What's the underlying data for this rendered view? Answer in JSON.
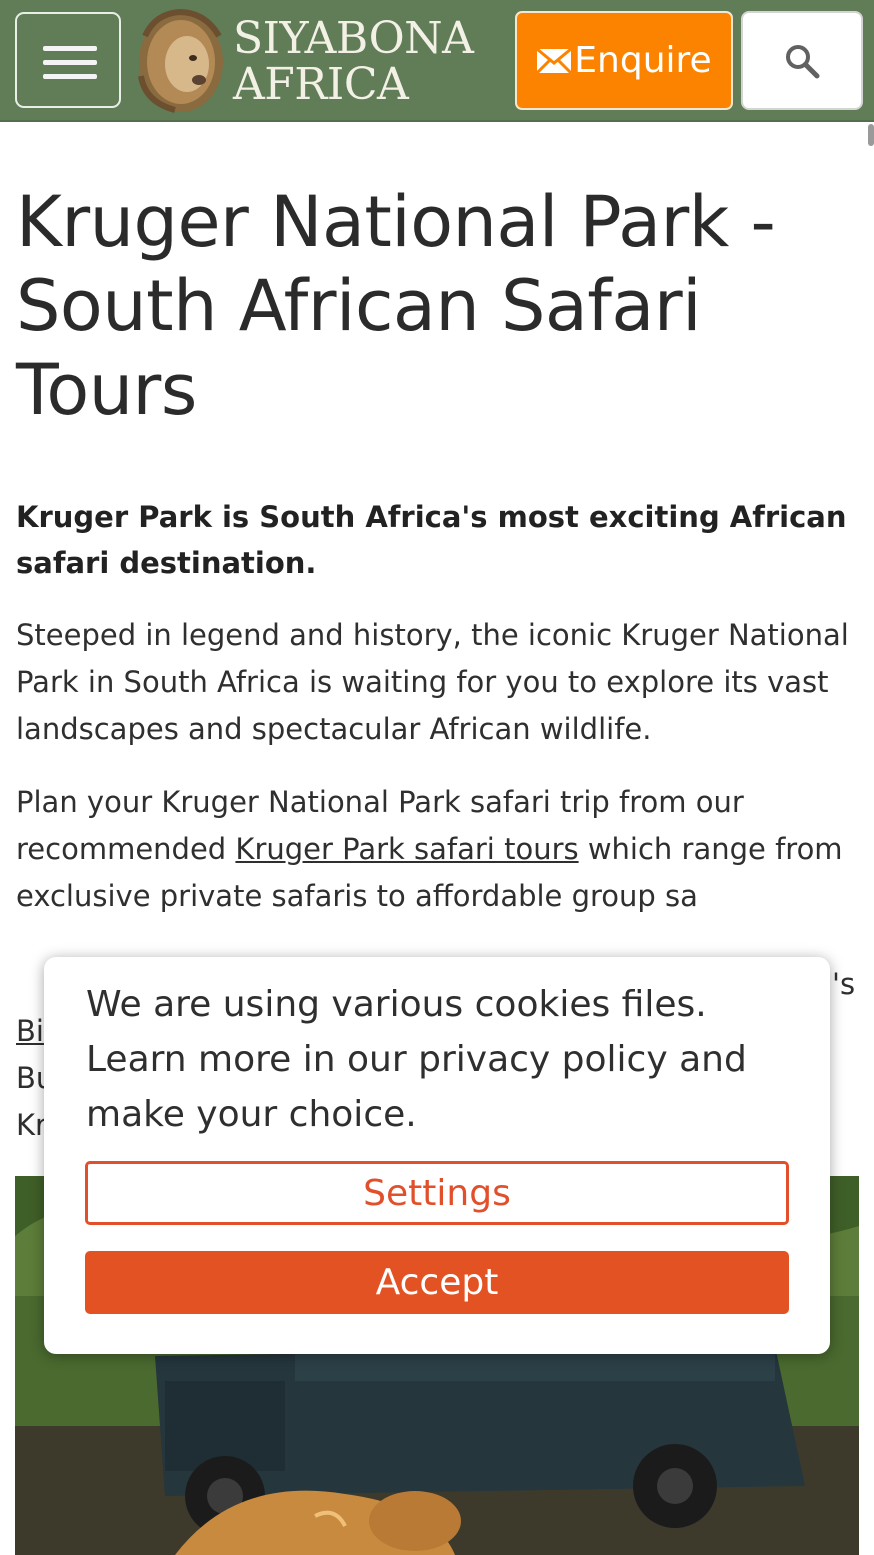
{
  "header": {
    "menu_icon": "hamburger-icon",
    "logo_line1": "SIYABONA",
    "logo_line2": "AFRICA",
    "enquire_label": "Enquire",
    "enquire_icon": "mail-icon",
    "search_icon": "search-icon"
  },
  "main": {
    "title": "Kruger National Park - South African Safari Tours",
    "lead": "Kruger Park is South Africa's most exciting African safari destination.",
    "para1": "Steeped in legend and history, the iconic Kruger National Park in South Africa is waiting for you to explore its vast landscapes and spectacular African wildlife.",
    "para2_before": "Plan your Kruger National Park safari trip from our recommended ",
    "para2_link": "Kruger Park safari tours",
    "para2_after": " which range from exclusive private safaris to affordable group sa",
    "para2_right_fragment": "'s",
    "para2_line_bi": "Bi",
    "para2_line_bu": "Bu",
    "para2_line_kr": "Kr"
  },
  "cookie_banner": {
    "message": "We are using various cookies files. Learn more in our privacy policy and make your choice.",
    "settings_label": "Settings",
    "accept_label": "Accept"
  },
  "colors": {
    "header_bg": "#607d58",
    "enquire_bg": "#fb8300",
    "cookie_accent": "#e35223"
  }
}
